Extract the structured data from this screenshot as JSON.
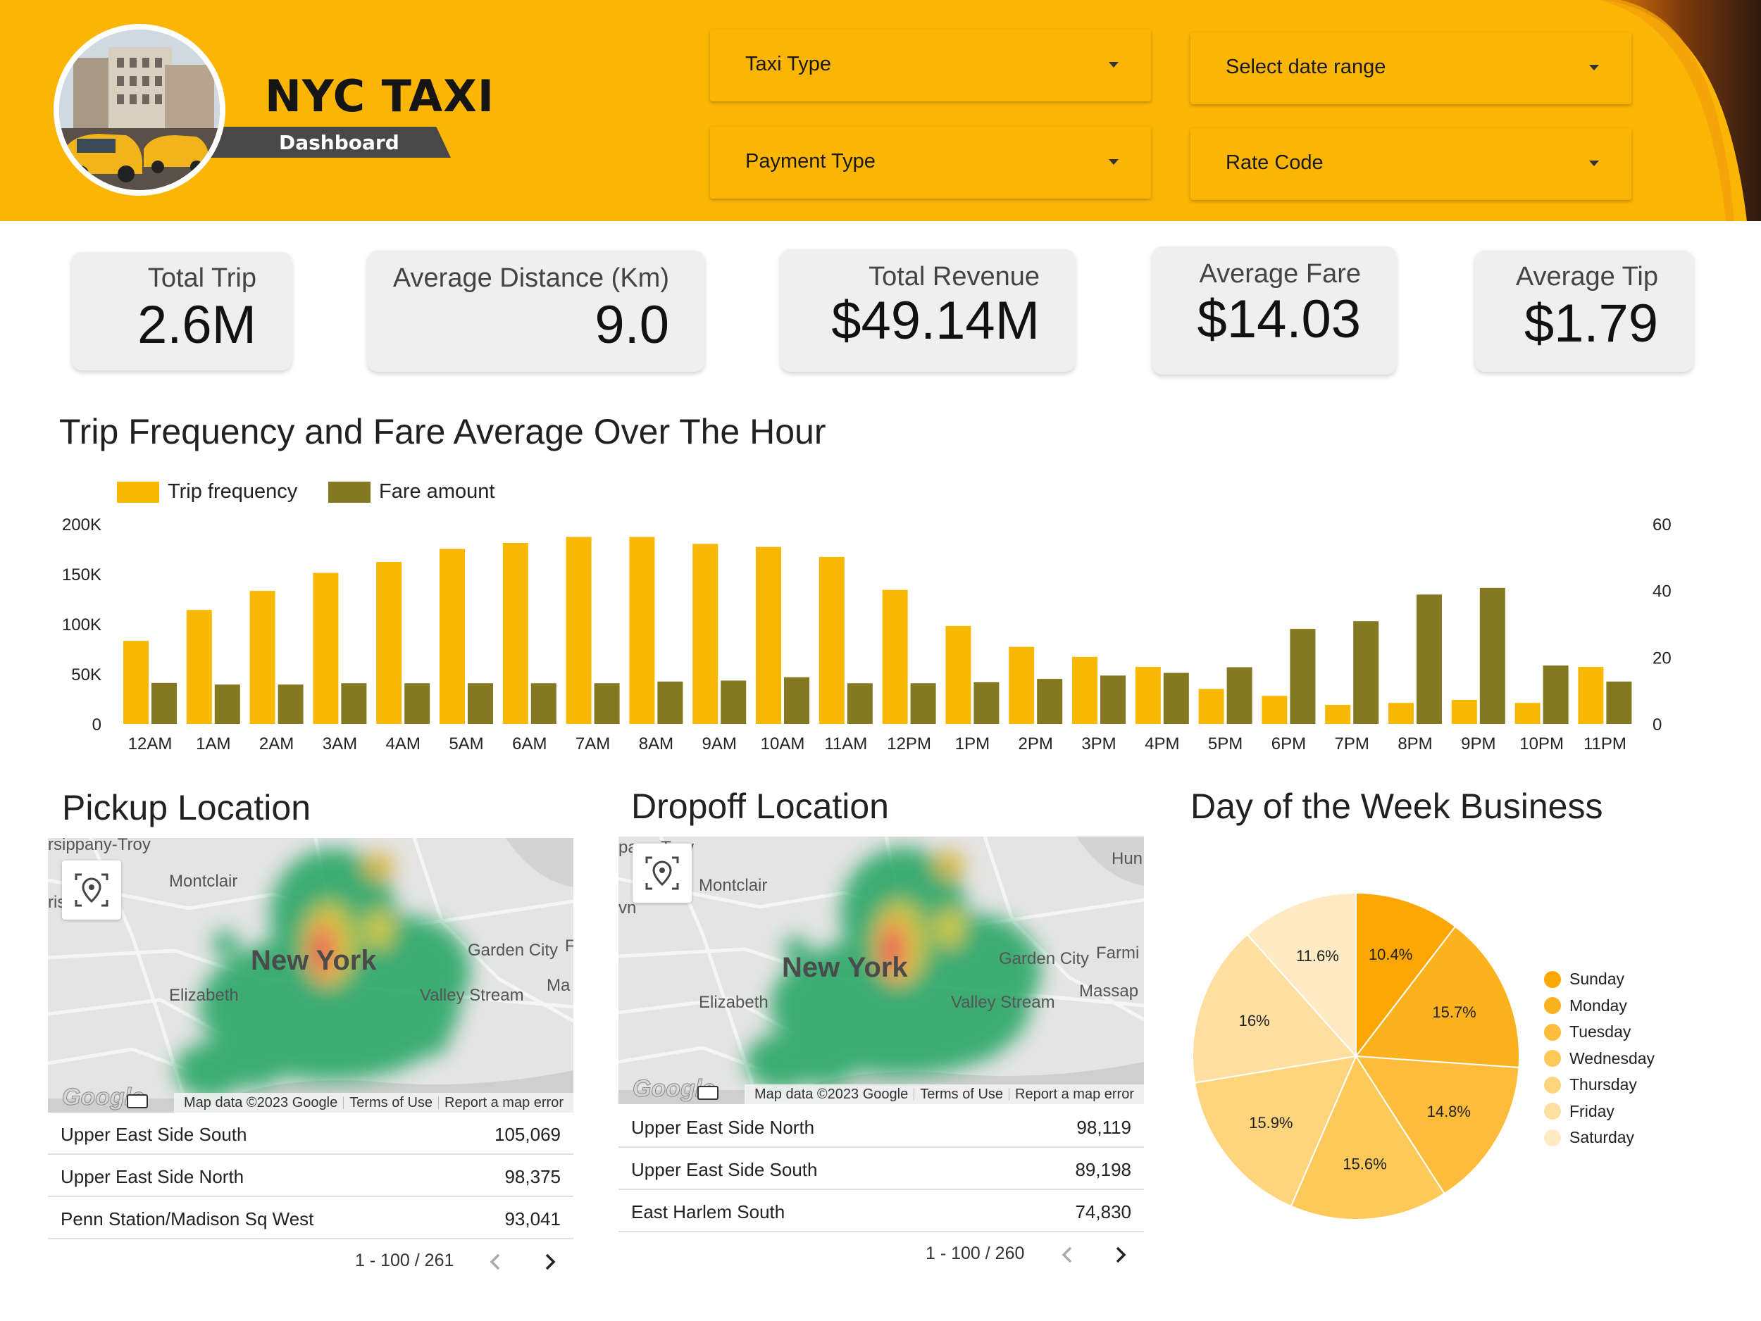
{
  "header": {
    "title": "NYC TAXI",
    "subtitle": "Dashboard",
    "filters": {
      "taxi_type": "Taxi Type",
      "date_range": "Select date range",
      "payment_type": "Payment Type",
      "rate_code": "Rate Code"
    }
  },
  "kpis": {
    "total_trip": {
      "label": "Total Trip",
      "value": "2.6M"
    },
    "avg_distance": {
      "label": "Average Distance (Km)",
      "value": "9.0"
    },
    "total_revenue": {
      "label": "Total Revenue",
      "value": "$49.14M"
    },
    "avg_fare": {
      "label": "Average Fare",
      "value": "$14.03"
    },
    "avg_tip": {
      "label": "Average Tip",
      "value": "$1.79"
    }
  },
  "colors": {
    "brand_yellow": "#fbb505",
    "trip_bar": "#f8b804",
    "fare_bar": "#847820",
    "pie": [
      "#fba602",
      "#fcb21f",
      "#fdbd3b",
      "#fdc95b",
      "#fed47d",
      "#fedfa1",
      "#ffeac4"
    ]
  },
  "chart_title": "Trip Frequency and Fare Average Over The Hour",
  "chart_data": [
    {
      "type": "bar",
      "title": "Trip Frequency and Fare Average Over The Hour",
      "categories": [
        "12AM",
        "1AM",
        "2AM",
        "3AM",
        "4AM",
        "5AM",
        "6AM",
        "7AM",
        "8AM",
        "9AM",
        "10AM",
        "11AM",
        "12PM",
        "1PM",
        "2PM",
        "3PM",
        "4PM",
        "5PM",
        "6PM",
        "7PM",
        "8PM",
        "9PM",
        "10PM",
        "11PM"
      ],
      "series": [
        {
          "name": "Trip frequency",
          "axis": "left",
          "values": [
            83000,
            114000,
            133000,
            151000,
            162000,
            175000,
            181000,
            187000,
            187000,
            180000,
            177000,
            167000,
            134000,
            98000,
            77000,
            67000,
            57000,
            35000,
            28000,
            19000,
            21000,
            24000,
            21000,
            57000
          ]
        },
        {
          "name": "Fare amount",
          "axis": "right",
          "values": [
            12.3,
            11.8,
            11.8,
            12.2,
            12.2,
            12.2,
            12.2,
            12.2,
            12.7,
            13.0,
            14.0,
            12.2,
            12.2,
            12.5,
            13.5,
            14.5,
            15.3,
            17.0,
            28.5,
            30.8,
            38.8,
            40.8,
            17.5,
            12.7
          ]
        }
      ],
      "left_ticks": [
        "0",
        "50K",
        "100K",
        "150K",
        "200K"
      ],
      "right_ticks": [
        "0",
        "20",
        "40",
        "60"
      ],
      "ylim_left": [
        0,
        200000
      ],
      "ylim_right": [
        0,
        60
      ],
      "legend": "top-left"
    },
    {
      "type": "pie",
      "title": "Day of the Week Business",
      "categories": [
        "Sunday",
        "Monday",
        "Tuesday",
        "Wednesday",
        "Thursday",
        "Friday",
        "Saturday"
      ],
      "values": [
        10.4,
        15.7,
        14.8,
        15.6,
        15.9,
        16,
        11.6
      ],
      "labels": [
        "10.4%",
        "15.7%",
        "14.8%",
        "15.6%",
        "15.9%",
        "16%",
        "11.6%"
      ],
      "legend": "right"
    }
  ],
  "pickup": {
    "title": "Pickup Location",
    "map": {
      "places": [
        "rsippany-Troy",
        "Montclair",
        "ris",
        "New York",
        "Garden City",
        "Elizabeth",
        "Valley Stream",
        "Ma",
        "F"
      ],
      "attribution": [
        "Map data ©2023 Google",
        "Terms of Use",
        "Report a map error"
      ],
      "logo": "Google"
    },
    "rows": [
      {
        "name": "Upper East Side South",
        "value": "105,069"
      },
      {
        "name": "Upper East Side North",
        "value": "98,375"
      },
      {
        "name": "Penn Station/Madison Sq West",
        "value": "93,041"
      }
    ],
    "pager": "1 - 100 / 261"
  },
  "dropoff": {
    "title": "Dropoff Location",
    "map": {
      "places": [
        "pany-Troy",
        "Montclair",
        "Hun",
        "vn",
        "New York",
        "Garden City",
        "Farmi",
        "Elizabeth",
        "Valley Stream",
        "Massap"
      ],
      "attribution": [
        "Map data ©2023 Google",
        "Terms of Use",
        "Report a map error"
      ],
      "logo": "Google"
    },
    "rows": [
      {
        "name": "Upper East Side North",
        "value": "98,119"
      },
      {
        "name": "Upper East Side South",
        "value": "89,198"
      },
      {
        "name": "East Harlem South",
        "value": "74,830"
      }
    ],
    "pager": "1 - 100 / 260"
  },
  "day_of_week": {
    "title": "Day of the Week Business"
  }
}
